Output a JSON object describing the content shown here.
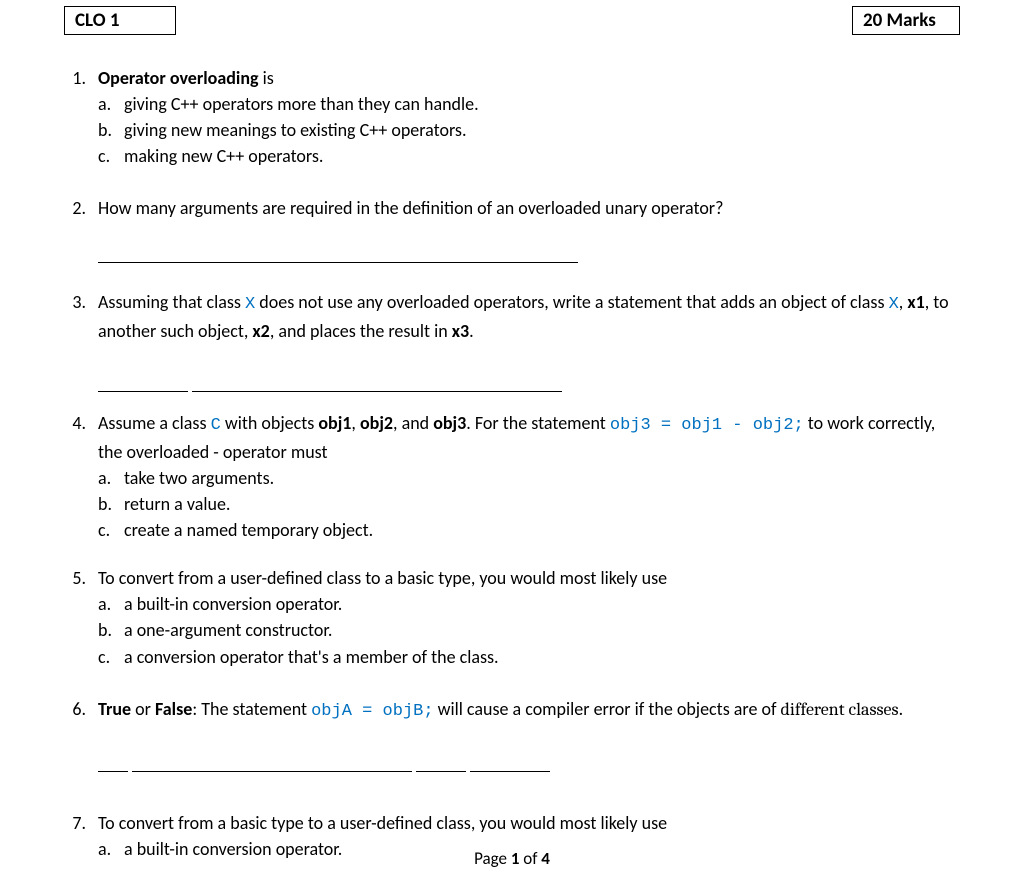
{
  "header": {
    "left": "CLO 1",
    "right": "20  Marks"
  },
  "q1": {
    "num": "1.",
    "lead_bold": "Operator overloading",
    "lead_rest": " is",
    "opts": {
      "a": {
        "l": "a.",
        "t": "giving C++ operators more than they can handle."
      },
      "b": {
        "l": "b.",
        "t": "giving new meanings to existing C++ operators."
      },
      "c": {
        "l": "c.",
        "t": "making new C++ operators."
      }
    }
  },
  "q2": {
    "num": "2.",
    "text": "How many arguments are required in the definition of an overloaded unary operator?"
  },
  "q3": {
    "num": "3.",
    "p1": "Assuming that class ",
    "cx": "X",
    "p2": " does not use any overloaded operators, write a statement that adds an object of class ",
    "p_comma": ", ",
    "x1": "x1",
    "p3": ", to another such object, ",
    "x2": "x2",
    "p4": ", and places the result in ",
    "x3": "x3",
    "p5": "."
  },
  "q4": {
    "num": "4.",
    "p1": "Assume a class ",
    "cC": "C",
    "p2": " with objects ",
    "o1": "obj1",
    "pc1": ", ",
    "o2": "obj2",
    "pc2": ", and ",
    "o3": "obj3",
    "p3": ". For the statement ",
    "code": "obj3 = obj1 - obj2;",
    "p4": " to work correctly, the overloaded - operator must",
    "opts": {
      "a": {
        "l": "a.",
        "t": "take two arguments."
      },
      "b": {
        "l": "b.",
        "t": "return a value."
      },
      "c": {
        "l": "c.",
        "t": "create a named temporary object."
      }
    }
  },
  "q5": {
    "num": "5.",
    "text": "To convert from a user-defined class to a basic type, you would most likely use",
    "opts": {
      "a": {
        "l": "a.",
        "t": "a built-in conversion operator."
      },
      "b": {
        "l": "b.",
        "t": "a one-argument constructor."
      },
      "c": {
        "l": "c.",
        "t": "a conversion operator that's a member of the class."
      }
    }
  },
  "q6": {
    "num": "6.",
    "bTrue": "True",
    "or": " or ",
    "bFalse": "False",
    "p1": ": The statement ",
    "code": "objA = objB;",
    "p2": " will cause a compiler error if the objects are of ",
    "diff": "different classes",
    "p3": "."
  },
  "q7": {
    "num": "7.",
    "text": "To convert from a basic type to a user-defined class, you would most likely use",
    "opts": {
      "a": {
        "l": "a.",
        "t": "a built-in conversion operator."
      }
    }
  },
  "footer": {
    "p1": "Page ",
    "cur": "1",
    "of": " of ",
    "tot": "4"
  }
}
